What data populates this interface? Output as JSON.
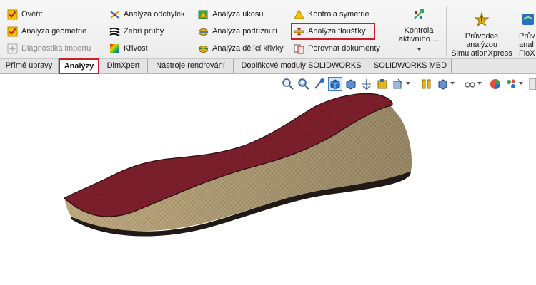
{
  "ribbon": {
    "group1": {
      "overit": "Ověřit",
      "analyza_geometrie": "Analýza geometrie",
      "diagnostika_importu": "Diagnostika importu"
    },
    "group2": {
      "analyza_odchylek": "Analýza odchylek",
      "zebri_pruhy": "Zebří pruhy",
      "krivost": "Křivost"
    },
    "group3": {
      "analyza_uhosu": "Analýza úkosu",
      "analyza_podriznuti": "Analýza podříznutí",
      "analyza_delici_krivky": "Analýza dělící křivky"
    },
    "group4": {
      "kontrola_symetrie": "Kontrola symetrie",
      "analyza_tloustky": "Analýza tloušťky",
      "porovnat_dokumenty": "Porovnat dokumenty"
    },
    "kontrola_aktivniho": {
      "line1": "Kontrola",
      "line2": "aktivního ..."
    },
    "pruvodce": {
      "line1": "Průvodce",
      "line2": "analýzou",
      "line3": "SimulationXpress"
    },
    "pruvodce_flo": {
      "line1": "Prův",
      "line2": "anal",
      "line3": "FloX"
    }
  },
  "tabs": [
    "Přímé úpravy",
    "Analýzy",
    "DimXpert",
    "Nástroje rendrování",
    "Doplňkové moduly SOLIDWORKS",
    "SOLIDWORKS MBD"
  ],
  "active_tab": "Analýzy",
  "view_toolbar_icons": [
    "zoom-to-fit-icon",
    "zoom-to-area-icon",
    "previous-view-icon",
    "section-view-icon",
    "view-orientation-icon",
    "display-style-icon",
    "hide-show-icon",
    "edit-appearance-icon",
    "apply-scene-icon",
    "view-settings-icon",
    "realview-icon"
  ],
  "colors": {
    "highlight": "#c8202a",
    "insole_top": "#7a1f2b",
    "insole_side": "#c9b48a",
    "ribbon_bg": "#f0f0f0"
  }
}
